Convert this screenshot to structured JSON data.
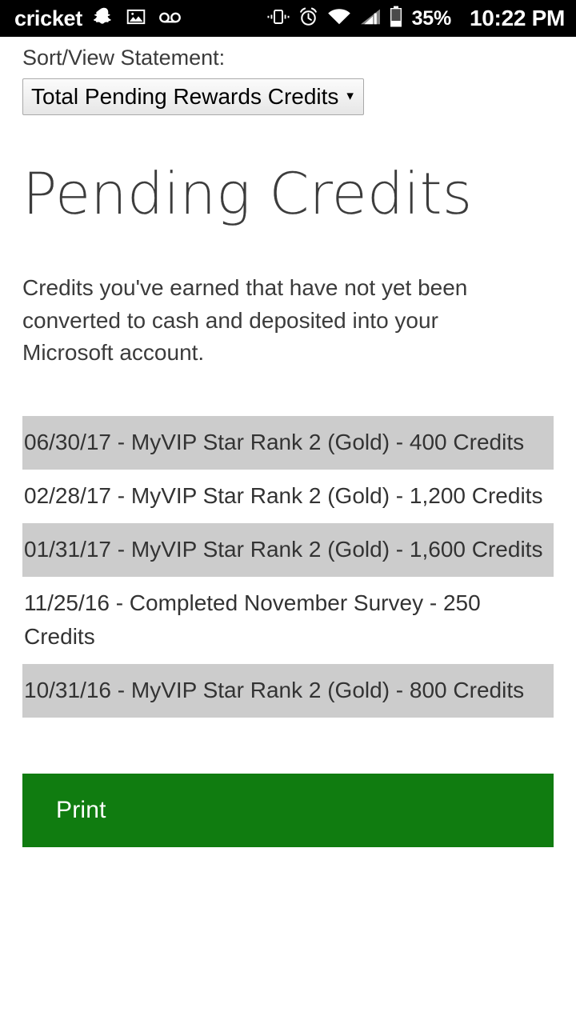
{
  "status_bar": {
    "carrier": "cricket",
    "icons_left": [
      "snapchat-icon",
      "image-icon",
      "voicemail-icon"
    ],
    "icons_right": [
      "vibrate-icon",
      "alarm-icon",
      "wifi-icon",
      "cellular-signal-icon",
      "battery-icon"
    ],
    "battery_percent": "35%",
    "time": "10:22 PM"
  },
  "sort": {
    "label": "Sort/View Statement:",
    "selected": "Total Pending Rewards Credits",
    "arrow": "▾",
    "options": [
      "Total Pending Rewards Credits"
    ]
  },
  "page": {
    "title": "Pending Credits",
    "description": "Credits you've earned that have not yet been converted to cash and deposited into your Microsoft account."
  },
  "credits": [
    {
      "text": "06/30/17 - MyVIP Star Rank 2 (Gold) - 400 Credits",
      "date": "06/30/17",
      "reason": "MyVIP Star Rank 2 (Gold)",
      "amount": "400 Credits",
      "shaded": true
    },
    {
      "text": "02/28/17 - MyVIP Star Rank 2 (Gold) - 1,200 Credits",
      "date": "02/28/17",
      "reason": "MyVIP Star Rank 2 (Gold)",
      "amount": "1,200 Credits",
      "shaded": false
    },
    {
      "text": "01/31/17 - MyVIP Star Rank 2 (Gold) - 1,600 Credits",
      "date": "01/31/17",
      "reason": "MyVIP Star Rank 2 (Gold)",
      "amount": "1,600 Credits",
      "shaded": true
    },
    {
      "text": "11/25/16 - Completed November Survey - 250 Credits",
      "date": "11/25/16",
      "reason": "Completed November Survey",
      "amount": "250 Credits",
      "shaded": false
    },
    {
      "text": "10/31/16 - MyVIP Star Rank 2 (Gold) - 800 Credits",
      "date": "10/31/16",
      "reason": "MyVIP Star Rank 2 (Gold)",
      "amount": "800 Credits",
      "shaded": true
    }
  ],
  "actions": {
    "print_label": "Print"
  },
  "colors": {
    "accent_green": "#107c10",
    "row_shade": "#cccccc",
    "status_bar_bg": "#000000",
    "text": "#333333"
  }
}
